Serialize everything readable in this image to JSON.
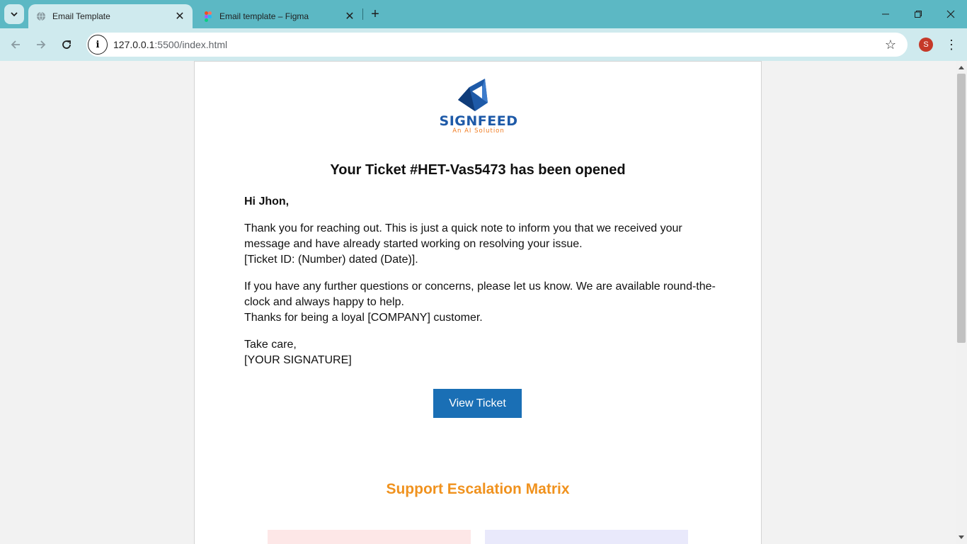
{
  "browser": {
    "tabs": [
      {
        "title": "Email Template",
        "active": true
      },
      {
        "title": "Email template – Figma",
        "active": false
      }
    ],
    "url_host": "127.0.0.1",
    "url_path": ":5500/index.html",
    "profile_initial": "S",
    "icons": {
      "tab_menu": "chevron-down-icon",
      "new_tab": "plus-icon",
      "back": "arrow-left-icon",
      "forward": "arrow-right-icon",
      "reload": "reload-icon",
      "site_info": "info-icon",
      "bookmark": "star-icon",
      "menu": "kebab-icon"
    }
  },
  "email": {
    "logo": {
      "brand": "SIGNFEED",
      "tagline": "An AI Solution"
    },
    "headline": "Your Ticket #HET-Vas5473 has been opened",
    "greeting": "Hi Jhon,",
    "para1_line1": "Thank you for reaching out. This is just a quick note to inform you that we received your message and have already started working on resolving your issue.",
    "para1_line2": "[Ticket ID: (Number) dated (Date)].",
    "para2_line1": "If you have any further questions or concerns, please let us know. We are available round-the-clock and always happy to help.",
    "para2_line2": "Thanks for being a loyal [COMPANY] customer.",
    "signoff": "Take care,",
    "signature": "[YOUR SIGNATURE]",
    "button_label": "View Ticket",
    "matrix_title": "Support Escalation Matrix"
  },
  "colors": {
    "tabbar": "#5cb8c4",
    "toolbar": "#cfeaee",
    "button": "#1a6fb5",
    "matrix_title": "#f0921e",
    "logo_blue": "#1e5aa8",
    "logo_orange": "#f07a1e"
  }
}
